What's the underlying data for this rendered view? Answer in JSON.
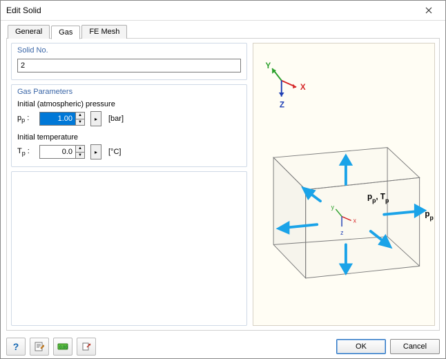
{
  "window": {
    "title": "Edit Solid"
  },
  "tabs": [
    {
      "label": "General",
      "active": false
    },
    {
      "label": "Gas",
      "active": true
    },
    {
      "label": "FE Mesh",
      "active": false
    }
  ],
  "groups": {
    "solid_no": {
      "title": "Solid No.",
      "value": "2"
    },
    "gas": {
      "title": "Gas Parameters",
      "pressure": {
        "label": "Initial (atmospheric) pressure",
        "symbol": "p_p",
        "value": "1.00",
        "unit": "[bar]"
      },
      "temperature": {
        "label": "Initial temperature",
        "symbol": "T_p",
        "value": "0.0",
        "unit": "[°C]"
      }
    }
  },
  "preview": {
    "global_axes": [
      "X",
      "Y",
      "Z"
    ],
    "local_axes": [
      "x",
      "y",
      "z"
    ],
    "labels_inside": "p_p, T_p",
    "label_outside": "p_p"
  },
  "footer": {
    "ok": "OK",
    "cancel": "Cancel",
    "icons": [
      "help",
      "note-pencil",
      "units",
      "import"
    ]
  }
}
